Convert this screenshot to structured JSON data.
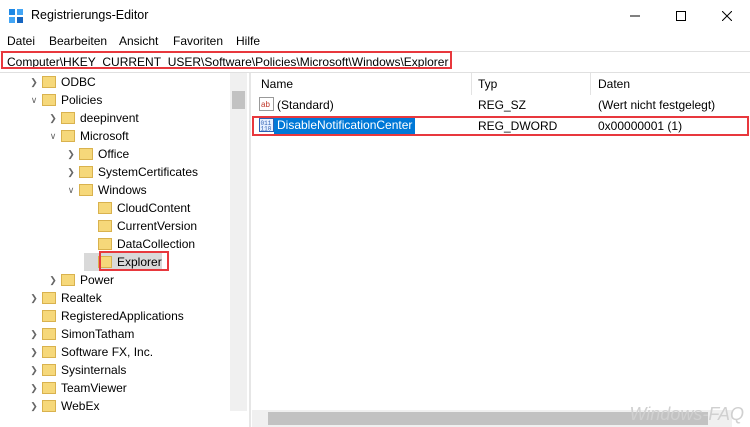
{
  "window": {
    "title": "Registrierungs-Editor",
    "controls": [
      "minimize-icon",
      "maximize-icon",
      "close-icon"
    ]
  },
  "menu": [
    "Datei",
    "Bearbeiten",
    "Ansicht",
    "Favoriten",
    "Hilfe"
  ],
  "address": "Computer\\HKEY_CURRENT_USER\\Software\\Policies\\Microsoft\\Windows\\Explorer",
  "tree": [
    {
      "label": "ODBC",
      "chevron": ">"
    },
    {
      "label": "Policies",
      "chevron": "v"
    },
    {
      "label": "deepinvent",
      "chevron": ">"
    },
    {
      "label": "Microsoft",
      "chevron": "v"
    },
    {
      "label": "Office",
      "chevron": ">"
    },
    {
      "label": "SystemCertificates",
      "chevron": ">"
    },
    {
      "label": "Windows",
      "chevron": "v"
    },
    {
      "label": "CloudContent",
      "chevron": ""
    },
    {
      "label": "CurrentVersion",
      "chevron": ""
    },
    {
      "label": "DataCollection",
      "chevron": ""
    },
    {
      "label": "Explorer",
      "chevron": ""
    },
    {
      "label": "Power",
      "chevron": ">"
    },
    {
      "label": "Realtek",
      "chevron": ">"
    },
    {
      "label": "RegisteredApplications",
      "chevron": ""
    },
    {
      "label": "SimonTatham",
      "chevron": ">"
    },
    {
      "label": "Software FX, Inc.",
      "chevron": ">"
    },
    {
      "label": "Sysinternals",
      "chevron": ">"
    },
    {
      "label": "TeamViewer",
      "chevron": ">"
    },
    {
      "label": "WebEx",
      "chevron": ">"
    }
  ],
  "columns": [
    "Name",
    "Typ",
    "Daten"
  ],
  "values": [
    {
      "name": "(Standard)",
      "type": "REG_SZ",
      "data": "(Wert nicht festgelegt)",
      "icon": "string-value-icon"
    },
    {
      "name": "DisableNotificationCenter",
      "type": "REG_DWORD",
      "data": "0x00000001 (1)",
      "icon": "binary-value-icon"
    }
  ],
  "watermark": "Windows-FAQ",
  "colors": {
    "selection": "#0078d7",
    "highlight_box": "#e8383d",
    "folder": "#f6d87a"
  }
}
